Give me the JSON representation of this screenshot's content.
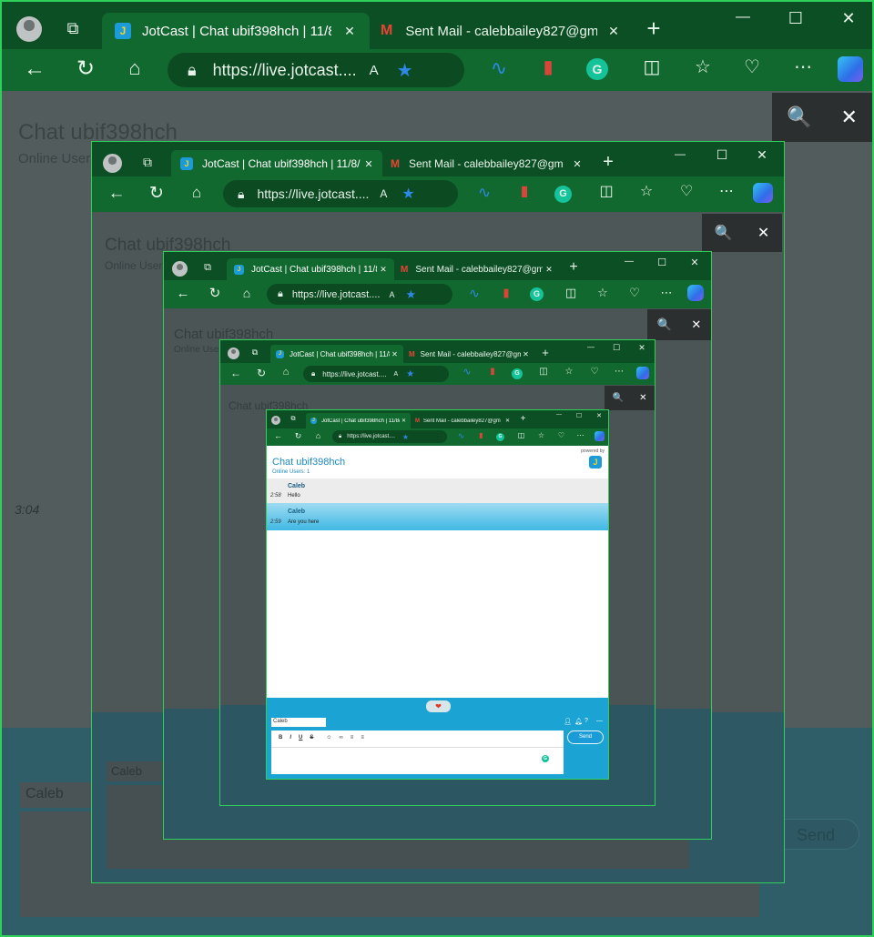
{
  "browser": {
    "active_tab": {
      "title": "JotCast | Chat ubif398hch | 11/8/",
      "favicon": "J"
    },
    "second_tab": {
      "title": "Sent Mail - calebbailey827@gm",
      "favicon": "M"
    },
    "url": "https://live.jotcast....",
    "new_tab": "+",
    "close": "✕",
    "more": "⋯",
    "window_controls": {
      "minimize": "—",
      "maximize": "☐",
      "close": "✕"
    }
  },
  "findbar": {
    "search_icon": "🔍",
    "close_icon": "✕"
  },
  "chat": {
    "title": "Chat ubif398hch",
    "online": "Online Users: 1",
    "powered_by": "powered by",
    "messages": [
      {
        "name": "Caleb",
        "time": "2:58",
        "text": "Hello"
      },
      {
        "name": "Caleb",
        "time": "2:59",
        "text": "Are you here"
      }
    ],
    "bg_time": "3:04",
    "composer": {
      "name_value": "Caleb",
      "send_label": "Send",
      "format": [
        "B",
        "I",
        "U",
        "S"
      ]
    }
  },
  "colors": {
    "accent": "#1ba3d4",
    "frame": "#105c2c",
    "border": "#2fd05a"
  }
}
